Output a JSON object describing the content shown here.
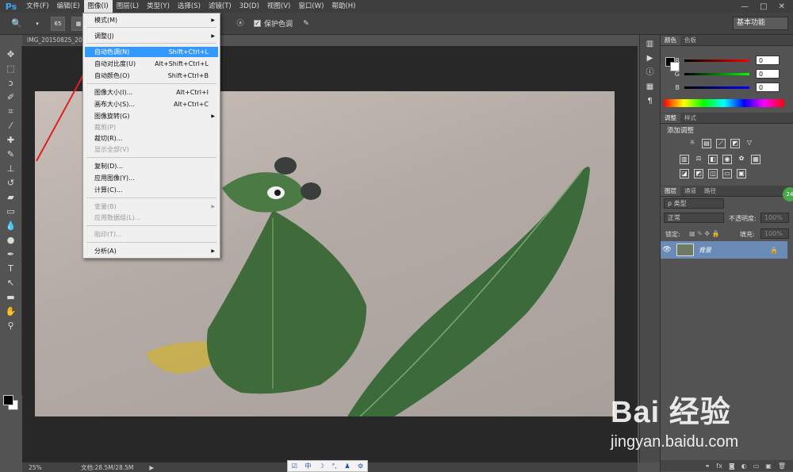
{
  "app": {
    "logo": "Ps"
  },
  "menubar": {
    "items": [
      "文件(F)",
      "编辑(E)",
      "图像(I)",
      "图层(L)",
      "类型(Y)",
      "选择(S)",
      "滤镜(T)",
      "3D(D)",
      "视图(V)",
      "窗口(W)",
      "帮助(H)"
    ],
    "active_index": 2,
    "window_controls": [
      "—",
      "□",
      "✕"
    ]
  },
  "optionsbar": {
    "brush_size": "65",
    "protect_tones_label": "保护色调",
    "protect_tones_checked": "✓",
    "workspace": "基本功能"
  },
  "document": {
    "tab_title": "IMG_20150825_20"
  },
  "image_menu": {
    "items": [
      {
        "label": "模式(M)",
        "shortcut": "",
        "submenu": "▶",
        "disabled": false,
        "highlighted": false
      },
      {
        "label": "调整(J)",
        "shortcut": "",
        "submenu": "▶",
        "disabled": false,
        "highlighted": false
      },
      {
        "label": "自动色调(N)",
        "shortcut": "Shift+Ctrl+L",
        "submenu": "",
        "disabled": false,
        "highlighted": true
      },
      {
        "label": "自动对比度(U)",
        "shortcut": "Alt+Shift+Ctrl+L",
        "submenu": "",
        "disabled": false,
        "highlighted": false
      },
      {
        "label": "自动颜色(O)",
        "shortcut": "Shift+Ctrl+B",
        "submenu": "",
        "disabled": false,
        "highlighted": false
      },
      {
        "label": "图像大小(I)...",
        "shortcut": "Alt+Ctrl+I",
        "submenu": "",
        "disabled": false,
        "highlighted": false
      },
      {
        "label": "画布大小(S)...",
        "shortcut": "Alt+Ctrl+C",
        "submenu": "",
        "disabled": false,
        "highlighted": false
      },
      {
        "label": "图像旋转(G)",
        "shortcut": "",
        "submenu": "▶",
        "disabled": false,
        "highlighted": false
      },
      {
        "label": "裁剪(P)",
        "shortcut": "",
        "submenu": "",
        "disabled": true,
        "highlighted": false
      },
      {
        "label": "裁切(R)...",
        "shortcut": "",
        "submenu": "",
        "disabled": false,
        "highlighted": false
      },
      {
        "label": "显示全部(V)",
        "shortcut": "",
        "submenu": "",
        "disabled": true,
        "highlighted": false
      },
      {
        "label": "复制(D)...",
        "shortcut": "",
        "submenu": "",
        "disabled": false,
        "highlighted": false
      },
      {
        "label": "应用图像(Y)...",
        "shortcut": "",
        "submenu": "",
        "disabled": false,
        "highlighted": false
      },
      {
        "label": "计算(C)...",
        "shortcut": "",
        "submenu": "",
        "disabled": false,
        "highlighted": false
      },
      {
        "label": "变量(B)",
        "shortcut": "",
        "submenu": "▶",
        "disabled": true,
        "highlighted": false
      },
      {
        "label": "应用数据组(L)...",
        "shortcut": "",
        "submenu": "",
        "disabled": true,
        "highlighted": false
      },
      {
        "label": "陷印(T)...",
        "shortcut": "",
        "submenu": "",
        "disabled": true,
        "highlighted": false
      },
      {
        "label": "分析(A)",
        "shortcut": "",
        "submenu": "▶",
        "disabled": false,
        "highlighted": false
      }
    ]
  },
  "statusbar": {
    "zoom": "25%",
    "doc_info": "文档:28.5M/28.5M",
    "arrow": "▶"
  },
  "ime": {
    "mode": "中",
    "icons": [
      "☽",
      "°,",
      "♟",
      "⚙"
    ]
  },
  "color_panel": {
    "tabs": [
      "颜色",
      "色板"
    ],
    "sliders": [
      {
        "label": "R",
        "value": "0",
        "color": "#ff0000"
      },
      {
        "label": "G",
        "value": "0",
        "color": "#00ff00"
      },
      {
        "label": "B",
        "value": "0",
        "color": "#0000ff"
      }
    ]
  },
  "adjust_panel": {
    "tabs": [
      "调整",
      "样式"
    ],
    "title": "添加调整"
  },
  "layers_panel": {
    "tabs": [
      "图层",
      "通道",
      "路径"
    ],
    "kind_filter": "ρ 类型",
    "blend_mode": "正常",
    "opacity_label": "不透明度:",
    "opacity_value": "100%",
    "lock_label": "锁定:",
    "fill_label": "填充:",
    "fill_value": "100%",
    "layer_name": "背景",
    "badge": "24"
  },
  "watermark": {
    "logo": "Bai 经验",
    "url": "jingyan.baidu.com"
  },
  "colors": {
    "menu_highlight": "#3399ff",
    "annotation_arrow": "#e02020",
    "layer_selected": "#6a8bb5"
  }
}
